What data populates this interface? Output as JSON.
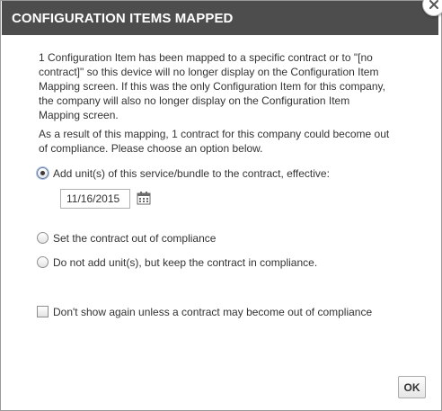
{
  "dialog": {
    "title": "CONFIGURATION ITEMS MAPPED",
    "close_icon": "close-icon",
    "message_1": "1 Configuration Item has been mapped to a specific contract or to \"[no contract]\" so this device will no longer display on the Configuration Item Mapping screen. If this was the only Configuration Item for this company, the company will also no longer display on the Configuration Item Mapping screen.",
    "message_2": "As a result of this mapping, 1 contract for this company could become out of compliance. Please choose an option below."
  },
  "options": {
    "add_units": {
      "label": "Add unit(s) of this service/bundle to the contract, effective:",
      "selected": true
    },
    "effective_date": "11/16/2015",
    "calendar_icon": "calendar-icon",
    "out_of_compliance": {
      "label": "Set the contract out of compliance",
      "selected": false
    },
    "keep_compliance": {
      "label": "Do not add unit(s), but keep the contract in compliance.",
      "selected": false
    }
  },
  "dont_show": {
    "label": "Don't show again unless a contract may become out of compliance",
    "checked": false
  },
  "buttons": {
    "ok": "OK"
  },
  "colors": {
    "titlebar": "#4d4d4d",
    "title_text": "#ffffff",
    "body_text": "#333333"
  }
}
